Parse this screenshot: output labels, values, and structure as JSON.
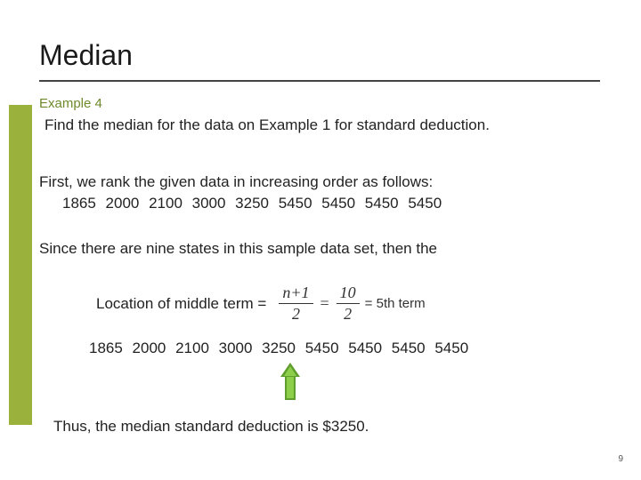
{
  "title": "Median",
  "example_label": "Example 4",
  "prompt": "Find the median for the data on Example 1 for standard deduction.",
  "rank_text": "First, we rank the given data in increasing order as follows:",
  "data_sorted_1": "1865   2000   2100   3000   3250   5450   5450   5450   5450",
  "since_text": "Since there are nine states in this sample data set, then the",
  "location_label": "Location of middle term =",
  "frac": {
    "num1": "n+1",
    "den1": "2",
    "num2": "10",
    "den2": "2",
    "result": "= 5th term"
  },
  "data_sorted_2": "1865   2000   2100   3000   3250   5450   5450   5450   5450",
  "conclusion": "Thus, the median standard deduction is $3250.",
  "page_number": "9"
}
